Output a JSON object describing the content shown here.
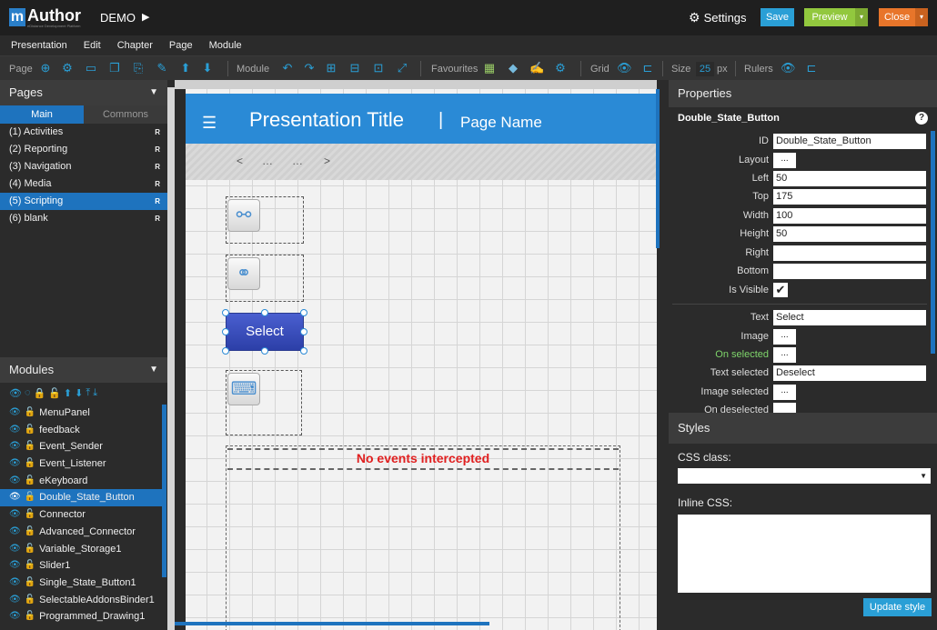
{
  "app": {
    "logo_mark": "m",
    "logo_name": "Author",
    "logo_tagline": "eDistance Development Platform",
    "project": "DEMO",
    "project_arrow": "▶",
    "settings_label": "Settings",
    "save_label": "Save",
    "preview_label": "Preview",
    "close_label": "Close",
    "dropdown_glyph": "▾"
  },
  "menu": [
    "Presentation",
    "Edit",
    "Chapter",
    "Page",
    "Module"
  ],
  "toolbar": {
    "page_label": "Page",
    "module_label": "Module",
    "favourites_label": "Favourites",
    "grid_label": "Grid",
    "size_label": "Size",
    "size_value": "25",
    "size_unit": "px",
    "rulers_label": "Rulers"
  },
  "pages_panel": {
    "title": "Pages",
    "collapse_glyph": "▼",
    "tab_main": "Main",
    "tab_commons": "Commons",
    "items": [
      {
        "label": "(1) Activities",
        "flag": "R"
      },
      {
        "label": "(2) Reporting",
        "flag": "R"
      },
      {
        "label": "(3) Navigation",
        "flag": "R"
      },
      {
        "label": "(4) Media",
        "flag": "R"
      },
      {
        "label": "(5) Scripting",
        "flag": "R"
      },
      {
        "label": "(6) blank",
        "flag": "R"
      }
    ],
    "selected_index": 4
  },
  "modules_panel": {
    "title": "Modules",
    "collapse_glyph": "▼",
    "items": [
      "MenuPanel",
      "feedback",
      "Event_Sender",
      "Event_Listener",
      "eKeyboard",
      "Double_State_Button",
      "Connector",
      "Advanced_Connector",
      "Variable_Storage1",
      "Slider1",
      "Single_State_Button1",
      "SelectableAddonsBinder1",
      "Programmed_Drawing1"
    ],
    "selected_index": 5
  },
  "canvas": {
    "hamburger_glyph": "☰",
    "presentation_title": "Presentation Title",
    "title_separator": "|",
    "page_name": "Page Name",
    "nav_prev": "<",
    "nav_dots_1": "…",
    "nav_dots_2": "…",
    "nav_next": ">",
    "select_button_text": "Select",
    "events_text": "No events intercepted"
  },
  "properties": {
    "title": "Properties",
    "module_name": "Double_State_Button",
    "help_glyph": "?",
    "dots": "...",
    "check_glyph": "✔",
    "fields": {
      "id": {
        "label": "ID",
        "value": "Double_State_Button"
      },
      "layout": {
        "label": "Layout"
      },
      "left": {
        "label": "Left",
        "value": "50"
      },
      "top": {
        "label": "Top",
        "value": "175"
      },
      "width": {
        "label": "Width",
        "value": "100"
      },
      "height": {
        "label": "Height",
        "value": "50"
      },
      "right": {
        "label": "Right",
        "value": ""
      },
      "bottom": {
        "label": "Bottom",
        "value": ""
      },
      "is_visible": {
        "label": "Is Visible",
        "checked": true
      },
      "text": {
        "label": "Text",
        "value": "Select"
      },
      "image": {
        "label": "Image"
      },
      "on_selected": {
        "label": "On selected"
      },
      "text_selected": {
        "label": "Text selected",
        "value": "Deselect"
      },
      "image_selected": {
        "label": "Image selected"
      },
      "on_deselected": {
        "label": "On deselected"
      }
    }
  },
  "styles": {
    "title": "Styles",
    "css_class_label": "CSS class:",
    "css_class_value": "",
    "inline_css_label": "Inline CSS:",
    "inline_css_value": "",
    "update_label": "Update style"
  },
  "colors": {
    "accent": "#2a9fd6",
    "selected": "#1e73be",
    "preview": "#92c83e",
    "close": "#e8752a",
    "events_text": "#e02020"
  }
}
